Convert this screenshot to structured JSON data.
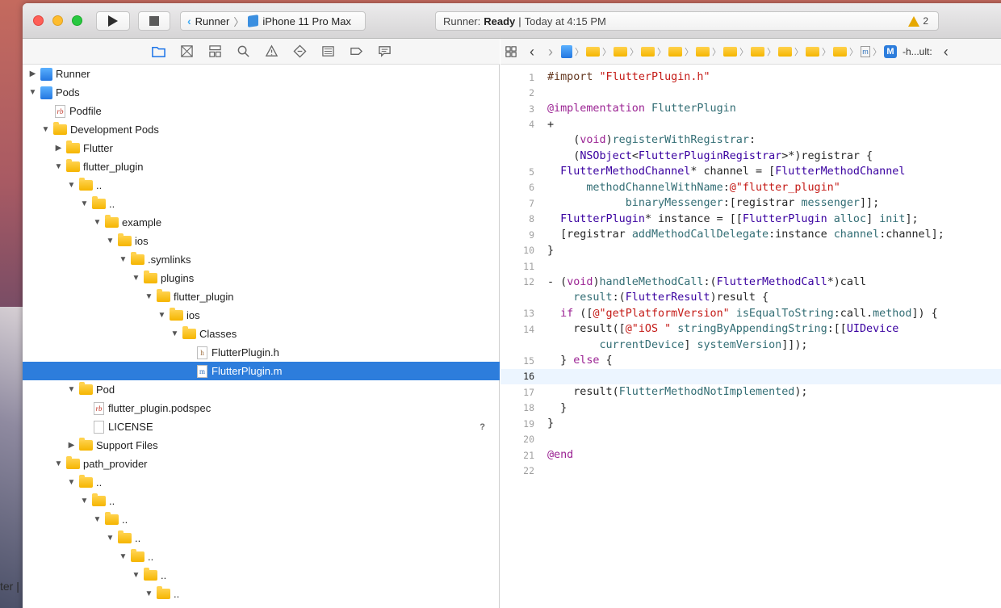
{
  "desktop": {
    "fragment_text": "ter |"
  },
  "toolbar": {
    "scheme_target": "Runner",
    "scheme_device": "iPhone 11 Pro Max",
    "status_app": "Runner:",
    "status_state": "Ready",
    "status_sep": "|",
    "status_time": "Today at 4:15 PM",
    "warning_count": "2"
  },
  "navigator": {
    "tabs": [
      "folder-icon",
      "source-control-icon",
      "symbol-icon",
      "find-icon",
      "issue-icon",
      "test-icon",
      "debug-icon",
      "breakpoint-icon",
      "report-icon"
    ],
    "tree": [
      {
        "label": "Runner",
        "depth": 0,
        "disc": "▶",
        "icon": "proj"
      },
      {
        "label": "Pods",
        "depth": 0,
        "disc": "▼",
        "icon": "proj"
      },
      {
        "label": "Podfile",
        "depth": 1,
        "disc": "",
        "icon": "rb"
      },
      {
        "label": "Development Pods",
        "depth": 1,
        "disc": "▼",
        "icon": "folder"
      },
      {
        "label": "Flutter",
        "depth": 2,
        "disc": "▶",
        "icon": "folder"
      },
      {
        "label": "flutter_plugin",
        "depth": 2,
        "disc": "▼",
        "icon": "folder"
      },
      {
        "label": "..",
        "depth": 3,
        "disc": "▼",
        "icon": "folder"
      },
      {
        "label": "..",
        "depth": 4,
        "disc": "▼",
        "icon": "folder"
      },
      {
        "label": "example",
        "depth": 5,
        "disc": "▼",
        "icon": "folder"
      },
      {
        "label": "ios",
        "depth": 6,
        "disc": "▼",
        "icon": "folder"
      },
      {
        "label": ".symlinks",
        "depth": 7,
        "disc": "▼",
        "icon": "folder"
      },
      {
        "label": "plugins",
        "depth": 8,
        "disc": "▼",
        "icon": "folder"
      },
      {
        "label": "flutter_plugin",
        "depth": 9,
        "disc": "▼",
        "icon": "folder"
      },
      {
        "label": "ios",
        "depth": 10,
        "disc": "▼",
        "icon": "folder"
      },
      {
        "label": "Classes",
        "depth": 11,
        "disc": "▼",
        "icon": "folder"
      },
      {
        "label": "FlutterPlugin.h",
        "depth": 12,
        "disc": "",
        "icon": "h"
      },
      {
        "label": "FlutterPlugin.m",
        "depth": 12,
        "disc": "",
        "icon": "m",
        "selected": true
      },
      {
        "label": "Pod",
        "depth": 3,
        "disc": "▼",
        "icon": "folder"
      },
      {
        "label": "flutter_plugin.podspec",
        "depth": 4,
        "disc": "",
        "icon": "rb"
      },
      {
        "label": "LICENSE",
        "depth": 4,
        "disc": "",
        "icon": "blank",
        "badge": "?"
      },
      {
        "label": "Support Files",
        "depth": 3,
        "disc": "▶",
        "icon": "folder"
      },
      {
        "label": "path_provider",
        "depth": 2,
        "disc": "▼",
        "icon": "folder"
      },
      {
        "label": "..",
        "depth": 3,
        "disc": "▼",
        "icon": "folder"
      },
      {
        "label": "..",
        "depth": 4,
        "disc": "▼",
        "icon": "folder"
      },
      {
        "label": "..",
        "depth": 5,
        "disc": "▼",
        "icon": "folder"
      },
      {
        "label": "..",
        "depth": 6,
        "disc": "▼",
        "icon": "folder"
      },
      {
        "label": "..",
        "depth": 7,
        "disc": "▼",
        "icon": "folder"
      },
      {
        "label": "..",
        "depth": 8,
        "disc": "▼",
        "icon": "folder"
      },
      {
        "label": "..",
        "depth": 9,
        "disc": "▼",
        "icon": "folder"
      }
    ]
  },
  "editor": {
    "jumpbar_symbol_letter": "M",
    "jumpbar_symbol_text": "-h...ult:",
    "jumpbar_file_letter": "m",
    "current_line": "16",
    "lines": [
      {
        "n": "1",
        "html": "<span class='dir'>#import</span> <span class='str'>\"FlutterPlugin.h\"</span>"
      },
      {
        "n": "2",
        "html": ""
      },
      {
        "n": "3",
        "html": "<span class='kw'>@implementation</span> <span class='fn'>FlutterPlugin</span>"
      },
      {
        "n": "4",
        "html": "+"
      },
      {
        "n": "",
        "html": "    (<span class='kw'>void</span>)<span class='fn'>registerWithRegistrar</span>:"
      },
      {
        "n": "",
        "html": "    (<span class='typ'>NSObject</span>&lt;<span class='typ'>FlutterPluginRegistrar</span>&gt;*)registrar {"
      },
      {
        "n": "5",
        "html": "  <span class='typ'>FlutterMethodChannel</span>* channel = [<span class='typ'>FlutterMethodChannel</span>"
      },
      {
        "n": "6",
        "html": "      <span class='fn'>methodChannelWithName</span>:<span class='str'>@\"flutter_plugin\"</span>"
      },
      {
        "n": "7",
        "html": "            <span class='fn'>binaryMessenger</span>:[registrar <span class='fn'>messenger</span>]];"
      },
      {
        "n": "8",
        "html": "  <span class='typ'>FlutterPlugin</span>* instance = [[<span class='typ'>FlutterPlugin</span> <span class='fn'>alloc</span>] <span class='fn'>init</span>];"
      },
      {
        "n": "9",
        "html": "  [registrar <span class='fn'>addMethodCallDelegate</span>:instance <span class='fn'>channel</span>:channel];"
      },
      {
        "n": "10",
        "html": "}"
      },
      {
        "n": "11",
        "html": ""
      },
      {
        "n": "12",
        "html": "- (<span class='kw'>void</span>)<span class='fn'>handleMethodCall</span>:(<span class='typ'>FlutterMethodCall</span>*)call"
      },
      {
        "n": "",
        "html": "    <span class='fn'>result</span>:(<span class='typ'>FlutterResult</span>)result {"
      },
      {
        "n": "13",
        "html": "  <span class='kw'>if</span> ([<span class='str'>@\"getPlatformVersion\"</span> <span class='fn'>isEqualToString</span>:call.<span class='fn'>method</span>]) {"
      },
      {
        "n": "14",
        "html": "    result([<span class='str'>@\"iOS \"</span> <span class='fn'>stringByAppendingString</span>:[[<span class='typ'>UIDevice</span>"
      },
      {
        "n": "",
        "html": "        <span class='fn'>currentDevice</span>] <span class='fn'>systemVersion</span>]]);"
      },
      {
        "n": "15",
        "html": "  } <span class='kw'>else</span> {"
      },
      {
        "n": "16",
        "html": ""
      },
      {
        "n": "17",
        "html": "    result(<span class='fn'>FlutterMethodNotImplemented</span>);"
      },
      {
        "n": "18",
        "html": "  }"
      },
      {
        "n": "19",
        "html": "}"
      },
      {
        "n": "20",
        "html": ""
      },
      {
        "n": "21",
        "html": "<span class='kw'>@end</span>"
      },
      {
        "n": "22",
        "html": ""
      }
    ]
  }
}
